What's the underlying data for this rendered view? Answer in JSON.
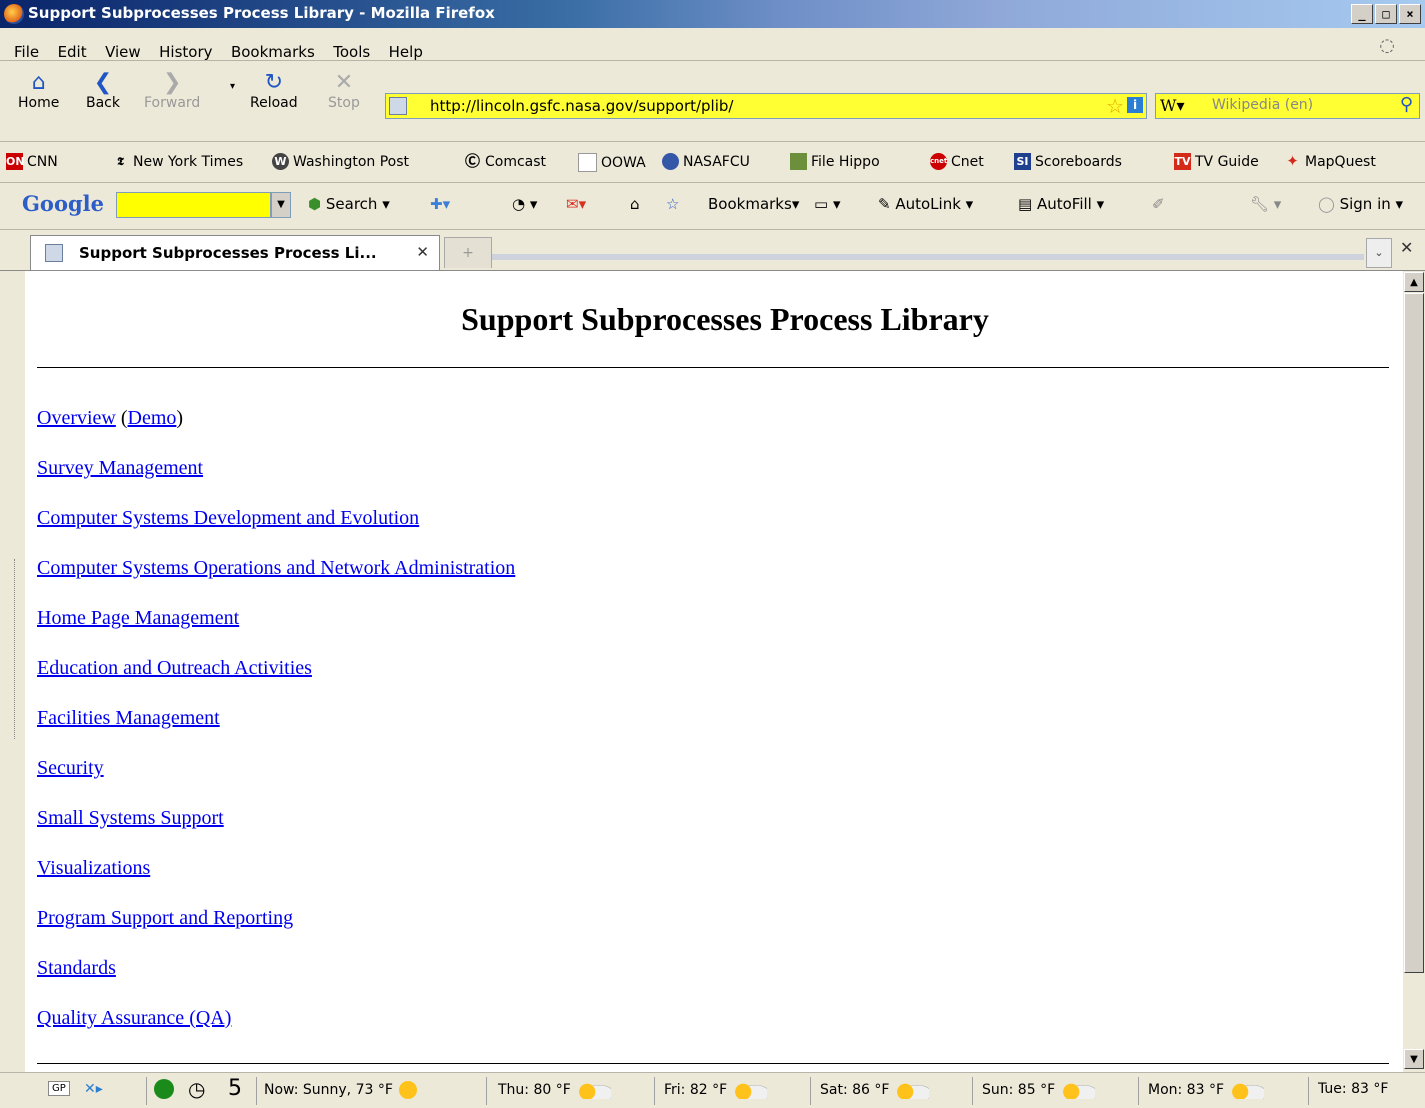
{
  "window": {
    "title": "Support Subprocesses Process Library - Mozilla Firefox"
  },
  "menu": [
    "File",
    "Edit",
    "View",
    "History",
    "Bookmarks",
    "Tools",
    "Help"
  ],
  "nav": {
    "home": "Home",
    "back": "Back",
    "forward": "Forward",
    "reload": "Reload",
    "stop": "Stop",
    "url": "http://lincoln.gsfc.nasa.gov/support/plib/",
    "search_placeholder": "Wikipedia (en)"
  },
  "bookmarks": [
    "CNN",
    "New York Times",
    "Washington Post",
    "Comcast",
    "OOWA",
    "NASAFCU",
    "File Hippo",
    "Cnet",
    "Scoreboards",
    "TV Guide",
    "MapQuest"
  ],
  "google_toolbar": {
    "logo": "Google",
    "search": "Search",
    "bookmarks": "Bookmarks",
    "autolink": "AutoLink",
    "autofill": "AutoFill",
    "signin": "Sign in"
  },
  "tab": {
    "title": "Support Subprocesses Process Li..."
  },
  "page": {
    "heading": "Support Subprocesses Process Library",
    "overview": "Overview",
    "demo": "Demo",
    "links": [
      "Survey Management",
      "Computer Systems Development and Evolution",
      "Computer Systems Operations and Network Administration",
      "Home Page Management",
      "Education and Outreach Activities",
      "Facilities Management",
      "Security",
      "Small Systems Support",
      "Visualizations",
      "Program Support and Reporting",
      "Standards",
      "Quality Assurance (QA)"
    ]
  },
  "status": {
    "gp": "GP",
    "count": "5",
    "weather": [
      "Now: Sunny, 73 °F",
      "Thu: 80 °F",
      "Fri: 82 °F",
      "Sat: 86 °F",
      "Sun: 85 °F",
      "Mon: 83 °F",
      "Tue: 83 °F"
    ]
  }
}
